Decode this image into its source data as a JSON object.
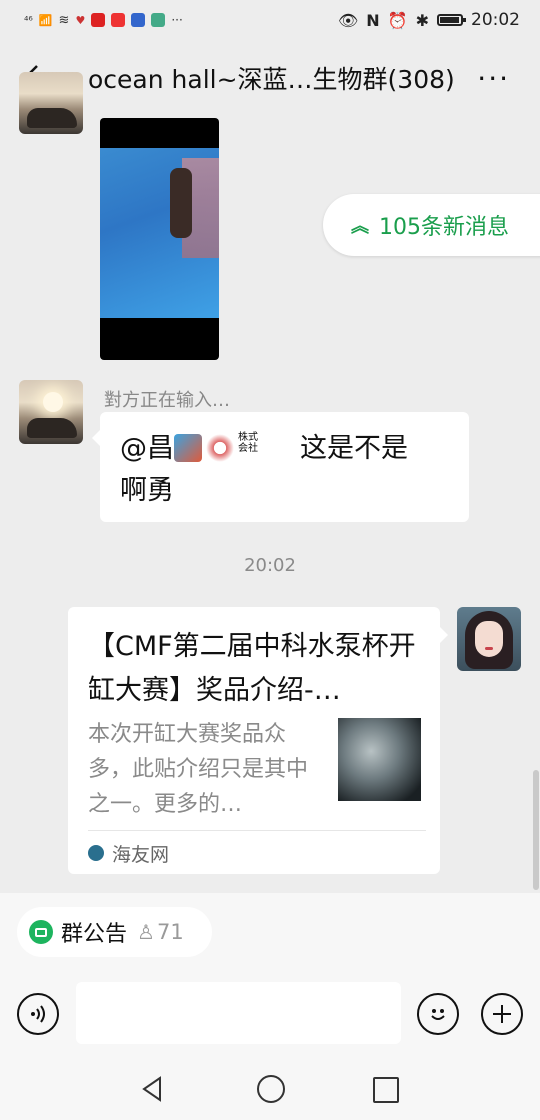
{
  "status_bar": {
    "network": "⁴⁶",
    "time": "20:02",
    "more": "···"
  },
  "header": {
    "title": "ocean hall~深蓝…生物群(308)",
    "more": "···"
  },
  "new_messages": {
    "label": "105条新消息"
  },
  "messages": {
    "typing": "對方正在输入…",
    "text_line1_prefix": "@昌",
    "text_line1_suffix": "这是不是",
    "text_line2": "啊勇",
    "emoji_label": "株式\n会社"
  },
  "time_separator": "20:02",
  "link_card": {
    "title": "【CMF第二届中科水泵杯开缸大赛】奖品介绍-…",
    "description": "本次开缸大赛奖品众多，此贴介绍只是其中之一。更多的…",
    "source": "海友网"
  },
  "announcement": {
    "label": "群公告",
    "count": "71"
  },
  "colors": {
    "accent_green": "#1a9e4c",
    "background": "#ededed"
  }
}
